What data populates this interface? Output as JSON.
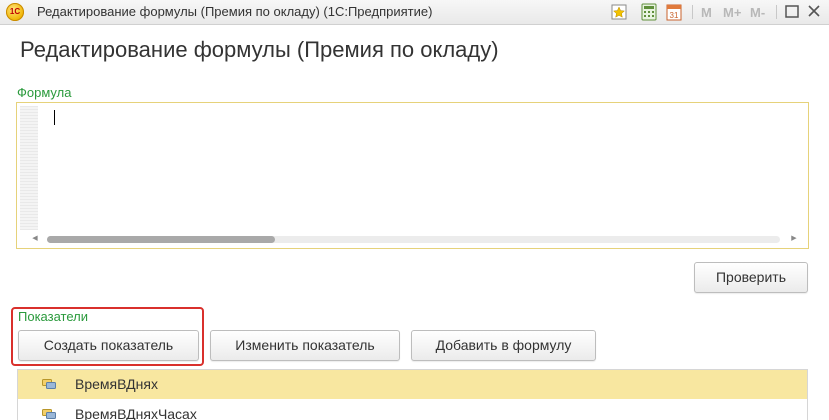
{
  "window": {
    "title": "Редактирование формулы (Премия по окладу)  (1С:Предприятие)",
    "logo_text": "1С",
    "toolbar": {
      "m_label": "M",
      "mplus_label": "M+",
      "mminus_label": "M-",
      "calendar_day": "31"
    }
  },
  "form": {
    "title": "Редактирование формулы (Премия по окладу)",
    "formula": {
      "label": "Формула",
      "value": ""
    },
    "check_button": "Проверить",
    "indicators": {
      "label": "Показатели",
      "buttons": {
        "create": "Создать показатель",
        "edit": "Изменить показатель",
        "add": "Добавить в формулу"
      },
      "rows": [
        {
          "label": "ВремяВДнях",
          "selected": true
        },
        {
          "label": "ВремяВДняхЧасах",
          "selected": false
        }
      ]
    }
  },
  "colors": {
    "accent_green": "#2a9a3c",
    "selection": "#f8e7a0",
    "highlight_red": "#d9302c"
  }
}
